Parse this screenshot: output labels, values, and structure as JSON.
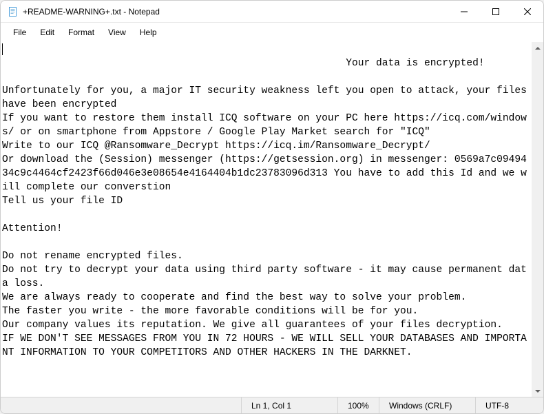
{
  "window": {
    "title": "+README-WARNING+.txt - Notepad"
  },
  "menu": {
    "file": "File",
    "edit": "Edit",
    "format": "Format",
    "view": "View",
    "help": "Help"
  },
  "editor": {
    "content": "                                                   Your data is encrypted!\n\nUnfortunately for you, a major IT security weakness left you open to attack, your files have been encrypted\nIf you want to restore them install ICQ software on your PC here https://icq.com/windows/ or on smartphone from Appstore / Google Play Market search for \"ICQ\"\nWrite to our ICQ @Ransomware_Decrypt https://icq.im/Ransomware_Decrypt/\nOr download the (Session) messenger (https://getsession.org) in messenger: 0569a7c0949434c9c4464cf2423f66d046e3e08654e4164404b1dc23783096d313 You have to add this Id and we will complete our converstion\nTell us your file ID\n\nAttention!\n\nDo not rename encrypted files.\nDo not try to decrypt your data using third party software - it may cause permanent data loss.\nWe are always ready to cooperate and find the best way to solve your problem.\nThe faster you write - the more favorable conditions will be for you.\nOur company values its reputation. We give all guarantees of your files decryption.\nIF WE DON'T SEE MESSAGES FROM YOU IN 72 HOURS - WE WILL SELL YOUR DATABASES AND IMPORTANT INFORMATION TO YOUR COMPETITORS AND OTHER HACKERS IN THE DARKNET."
  },
  "statusbar": {
    "position": "Ln 1, Col 1",
    "zoom": "100%",
    "line_endings": "Windows (CRLF)",
    "encoding": "UTF-8"
  }
}
